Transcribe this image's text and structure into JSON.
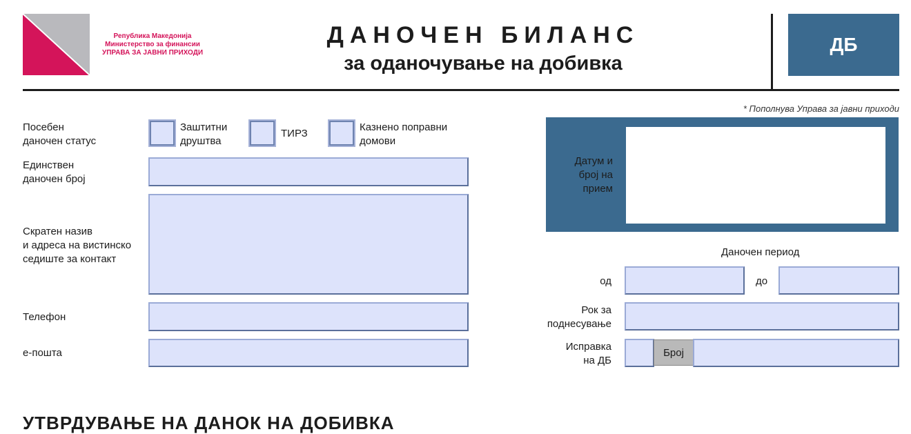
{
  "header": {
    "org_line1": "Република Македонија",
    "org_line2": "Министерство за финансии",
    "org_line3": "УПРАВА ЗА ЈАВНИ ПРИХОДИ",
    "title": "ДАНОЧЕН БИЛАНС",
    "subtitle": "за оданочување на добивка",
    "badge": "ДБ"
  },
  "note": "* Пополнува Управа за јавни приходи",
  "status": {
    "label_line1": "Посебен",
    "label_line2": "даночен статус",
    "options": [
      {
        "line1": "Заштитни",
        "line2": "друштва",
        "checked": false
      },
      {
        "line1": "ТИРЗ",
        "line2": "",
        "checked": false
      },
      {
        "line1": "Казнено поправни",
        "line2": "домови",
        "checked": false
      }
    ]
  },
  "fields": {
    "edb": {
      "label_line1": "Единствен",
      "label_line2": "даночен број",
      "value": ""
    },
    "name": {
      "label_line1": "Скратен назив",
      "label_line2": "и адреса на вистинско",
      "label_line3": "седиште за контакт",
      "value": ""
    },
    "phone": {
      "label": "Телефон",
      "value": ""
    },
    "email": {
      "label": "е-пошта",
      "value": ""
    }
  },
  "receipt": {
    "label_line1": "Датум и",
    "label_line2": "број на",
    "label_line3": "прием"
  },
  "period": {
    "heading": "Даночен период",
    "from_label": "од",
    "to_label": "до",
    "from_value": "",
    "to_value": ""
  },
  "deadline": {
    "label_line1": "Рок за",
    "label_line2": "поднесување",
    "value": ""
  },
  "correction": {
    "label_line1": "Исправка",
    "label_line2": "на ДБ",
    "number_label": "Број",
    "value": ""
  },
  "section_heading": "УТВРДУВАЊЕ НА ДАНОК НА ДОБИВКА",
  "colors": {
    "accent_blue": "#3b6a8f",
    "field_fill": "#dde3fb",
    "logo_magenta": "#d4145a",
    "logo_gray": "#b9b9bd"
  }
}
